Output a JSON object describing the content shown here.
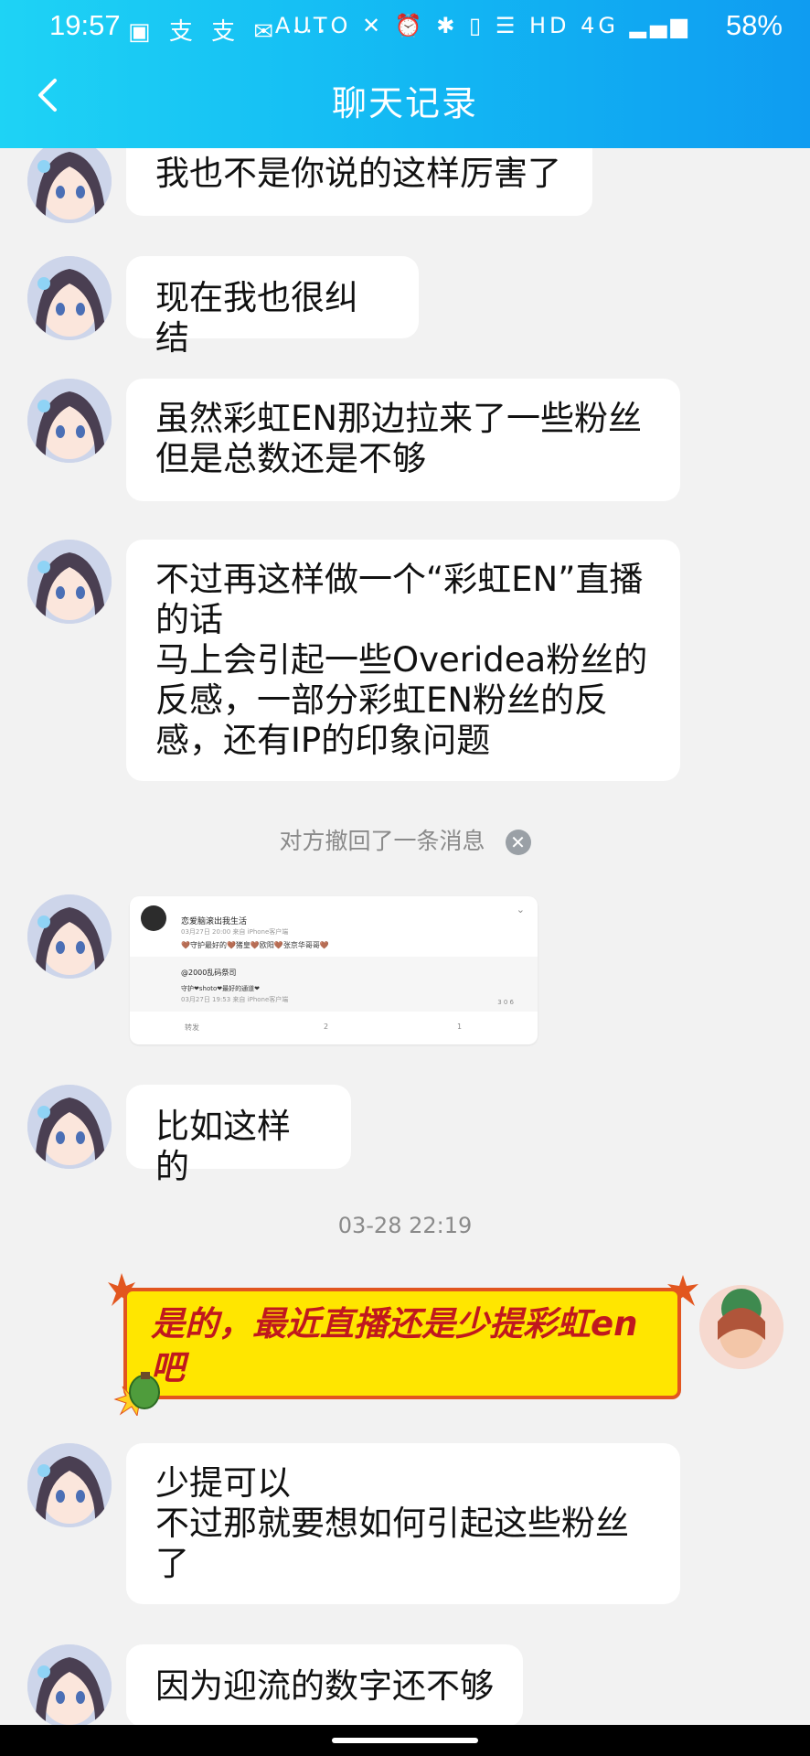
{
  "status_bar": {
    "time": "19:57",
    "left_icons": "▣ 支 支 ✉ ···",
    "right_icons": "AUTO ✕ ⏰ ✱ ▯ ☰ HD 4G ▂▄▆",
    "battery": "58%"
  },
  "header": {
    "title": "聊天记录"
  },
  "messages": [
    {
      "text": "我也不是你说的这样厉害了"
    },
    {
      "text": "现在我也很纠结"
    },
    {
      "text": "虽然彩虹EN那边拉来了一些粉丝\n但是总数还是不够"
    },
    {
      "text": "不过再这样做一个“彩虹EN”直播\n的话\n马上会引起一些Overidea粉丝的\n反感，一部分彩虹EN粉丝的反\n感，还有IP的印象问题"
    },
    {
      "text": "比如这样的"
    },
    {
      "text": "少提可以\n不过那就要想如何引起这些粉丝\n了"
    },
    {
      "text": "因为迎流的数字还不够"
    }
  ],
  "recall_notice": "对方撤回了一条消息",
  "timestamp": "03-28 22:19",
  "my_message": "是的，最近直播还是少提彩虹en\n吧",
  "screenshot_card": {
    "name": "恋爱脑滚出我生活",
    "meta": "03月27日 20:00  来自 iPhone客户端",
    "text": "🤎守护最好的🤎猪皇🤎欧阳🤎张京华哥哥🤎",
    "repost_name": "@2000乱码祭司",
    "repost_text": "守护❤shoto❤最好的通道❤",
    "repost_meta": "03月27日 19:53  来自 iPhone客户端",
    "repost_stats": "3     0     6",
    "foot_repost": "转发",
    "foot_comment": "2",
    "foot_like": "1"
  }
}
